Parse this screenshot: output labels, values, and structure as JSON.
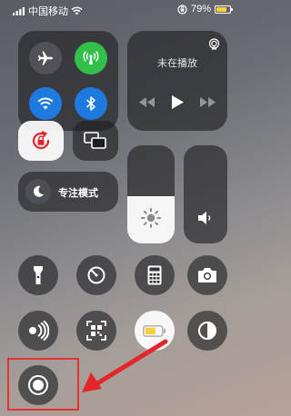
{
  "status_bar": {
    "carrier": "中国移动",
    "battery_percent": "79%",
    "battery_level": 0.79
  },
  "connectivity": {
    "airplane": {
      "active": false,
      "icon": "airplane-icon"
    },
    "cellular": {
      "active": true,
      "color": "#32c04a",
      "icon": "antenna-icon"
    },
    "wifi": {
      "active": true,
      "color": "#1f7ae0",
      "icon": "wifi-icon"
    },
    "bluetooth": {
      "active": true,
      "color": "#1f7ae0",
      "icon": "bluetooth-icon"
    }
  },
  "now_playing": {
    "status": "未在播放",
    "icons": [
      "airplay-icon",
      "previous-icon",
      "play-icon",
      "next-icon"
    ]
  },
  "focus": {
    "label": "专注模式",
    "icon": "moon-icon"
  },
  "brightness": {
    "level": 0.48
  },
  "volume": {
    "level": 0.0
  },
  "controls": [
    "flashlight-icon",
    "timer-icon",
    "calculator-icon",
    "camera-icon",
    "nfc-icon",
    "qr-scanner-icon",
    "low-power-icon",
    "dark-mode-icon",
    "screen-record-icon"
  ],
  "colors": {
    "highlight": "#e8322f",
    "accent_red": "#e4252a",
    "low_power": "#f3d23b"
  }
}
